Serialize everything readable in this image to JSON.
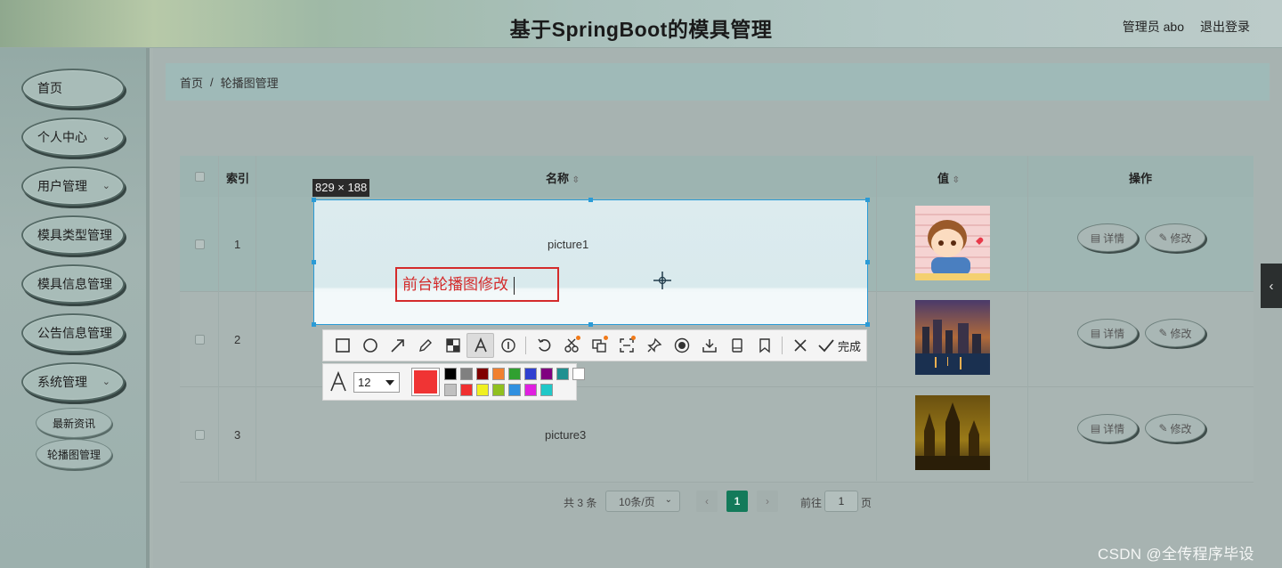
{
  "header": {
    "title": "基于SpringBoot的模具管理",
    "admin_label": "管理员 abo",
    "logout_label": "退出登录"
  },
  "sidebar": {
    "items": [
      {
        "label": "首页",
        "has_submenu": false
      },
      {
        "label": "个人中心",
        "has_submenu": true
      },
      {
        "label": "用户管理",
        "has_submenu": true
      },
      {
        "label": "模具类型管理",
        "has_submenu": true
      },
      {
        "label": "模具信息管理",
        "has_submenu": true
      },
      {
        "label": "公告信息管理",
        "has_submenu": true
      },
      {
        "label": "系统管理",
        "has_submenu": true,
        "expanded": true
      }
    ],
    "sub_items": [
      {
        "label": "最新资讯"
      },
      {
        "label": "轮播图管理",
        "active": true
      }
    ]
  },
  "breadcrumb": {
    "home": "首页",
    "separator": "/",
    "current": "轮播图管理"
  },
  "table": {
    "columns": {
      "index": "索引",
      "name": "名称",
      "value": "值",
      "actions": "操作"
    },
    "sort_icon": "⇳",
    "rows": [
      {
        "index": "1",
        "name": "picture1",
        "image": "cartoon-boy-thumbnail"
      },
      {
        "index": "2",
        "name": "picture2",
        "image": "city-night-thumbnail"
      },
      {
        "index": "3",
        "name": "picture3",
        "image": "cathedral-sunset-thumbnail"
      }
    ],
    "detail_label": "详情",
    "edit_label": "修改"
  },
  "pagination": {
    "total": "共 3 条",
    "page_size": "10条/页",
    "current_page": "1",
    "goto_label": "前往",
    "goto_value": "1",
    "page_suffix": "页"
  },
  "screenshot_tool": {
    "selection_size": "829 × 188",
    "annotation_text": "前台轮播图修改",
    "font_size": "12",
    "done_label": "完成",
    "current_color": "#f03434",
    "swatches": [
      "#000000",
      "#808080",
      "#800000",
      "#f08030",
      "#30a030",
      "#3040d0",
      "#800080",
      "#209090",
      "#ffffff",
      "#c0c0c0",
      "#f03030",
      "#f0f020",
      "#90c020",
      "#3090e0",
      "#e020e0",
      "#20c8c8"
    ],
    "tools": [
      "rectangle-tool",
      "ellipse-tool",
      "arrow-tool",
      "pen-tool",
      "mosaic-tool",
      "text-tool",
      "number-tool",
      "undo-tool",
      "ocr-tool",
      "translate-tool",
      "scan-tool",
      "pin-tool",
      "record-tool",
      "download-tool",
      "long-screenshot-tool",
      "bookmark-tool",
      "close-tool",
      "done-tool"
    ]
  },
  "watermark": "CSDN @全传程序毕设"
}
